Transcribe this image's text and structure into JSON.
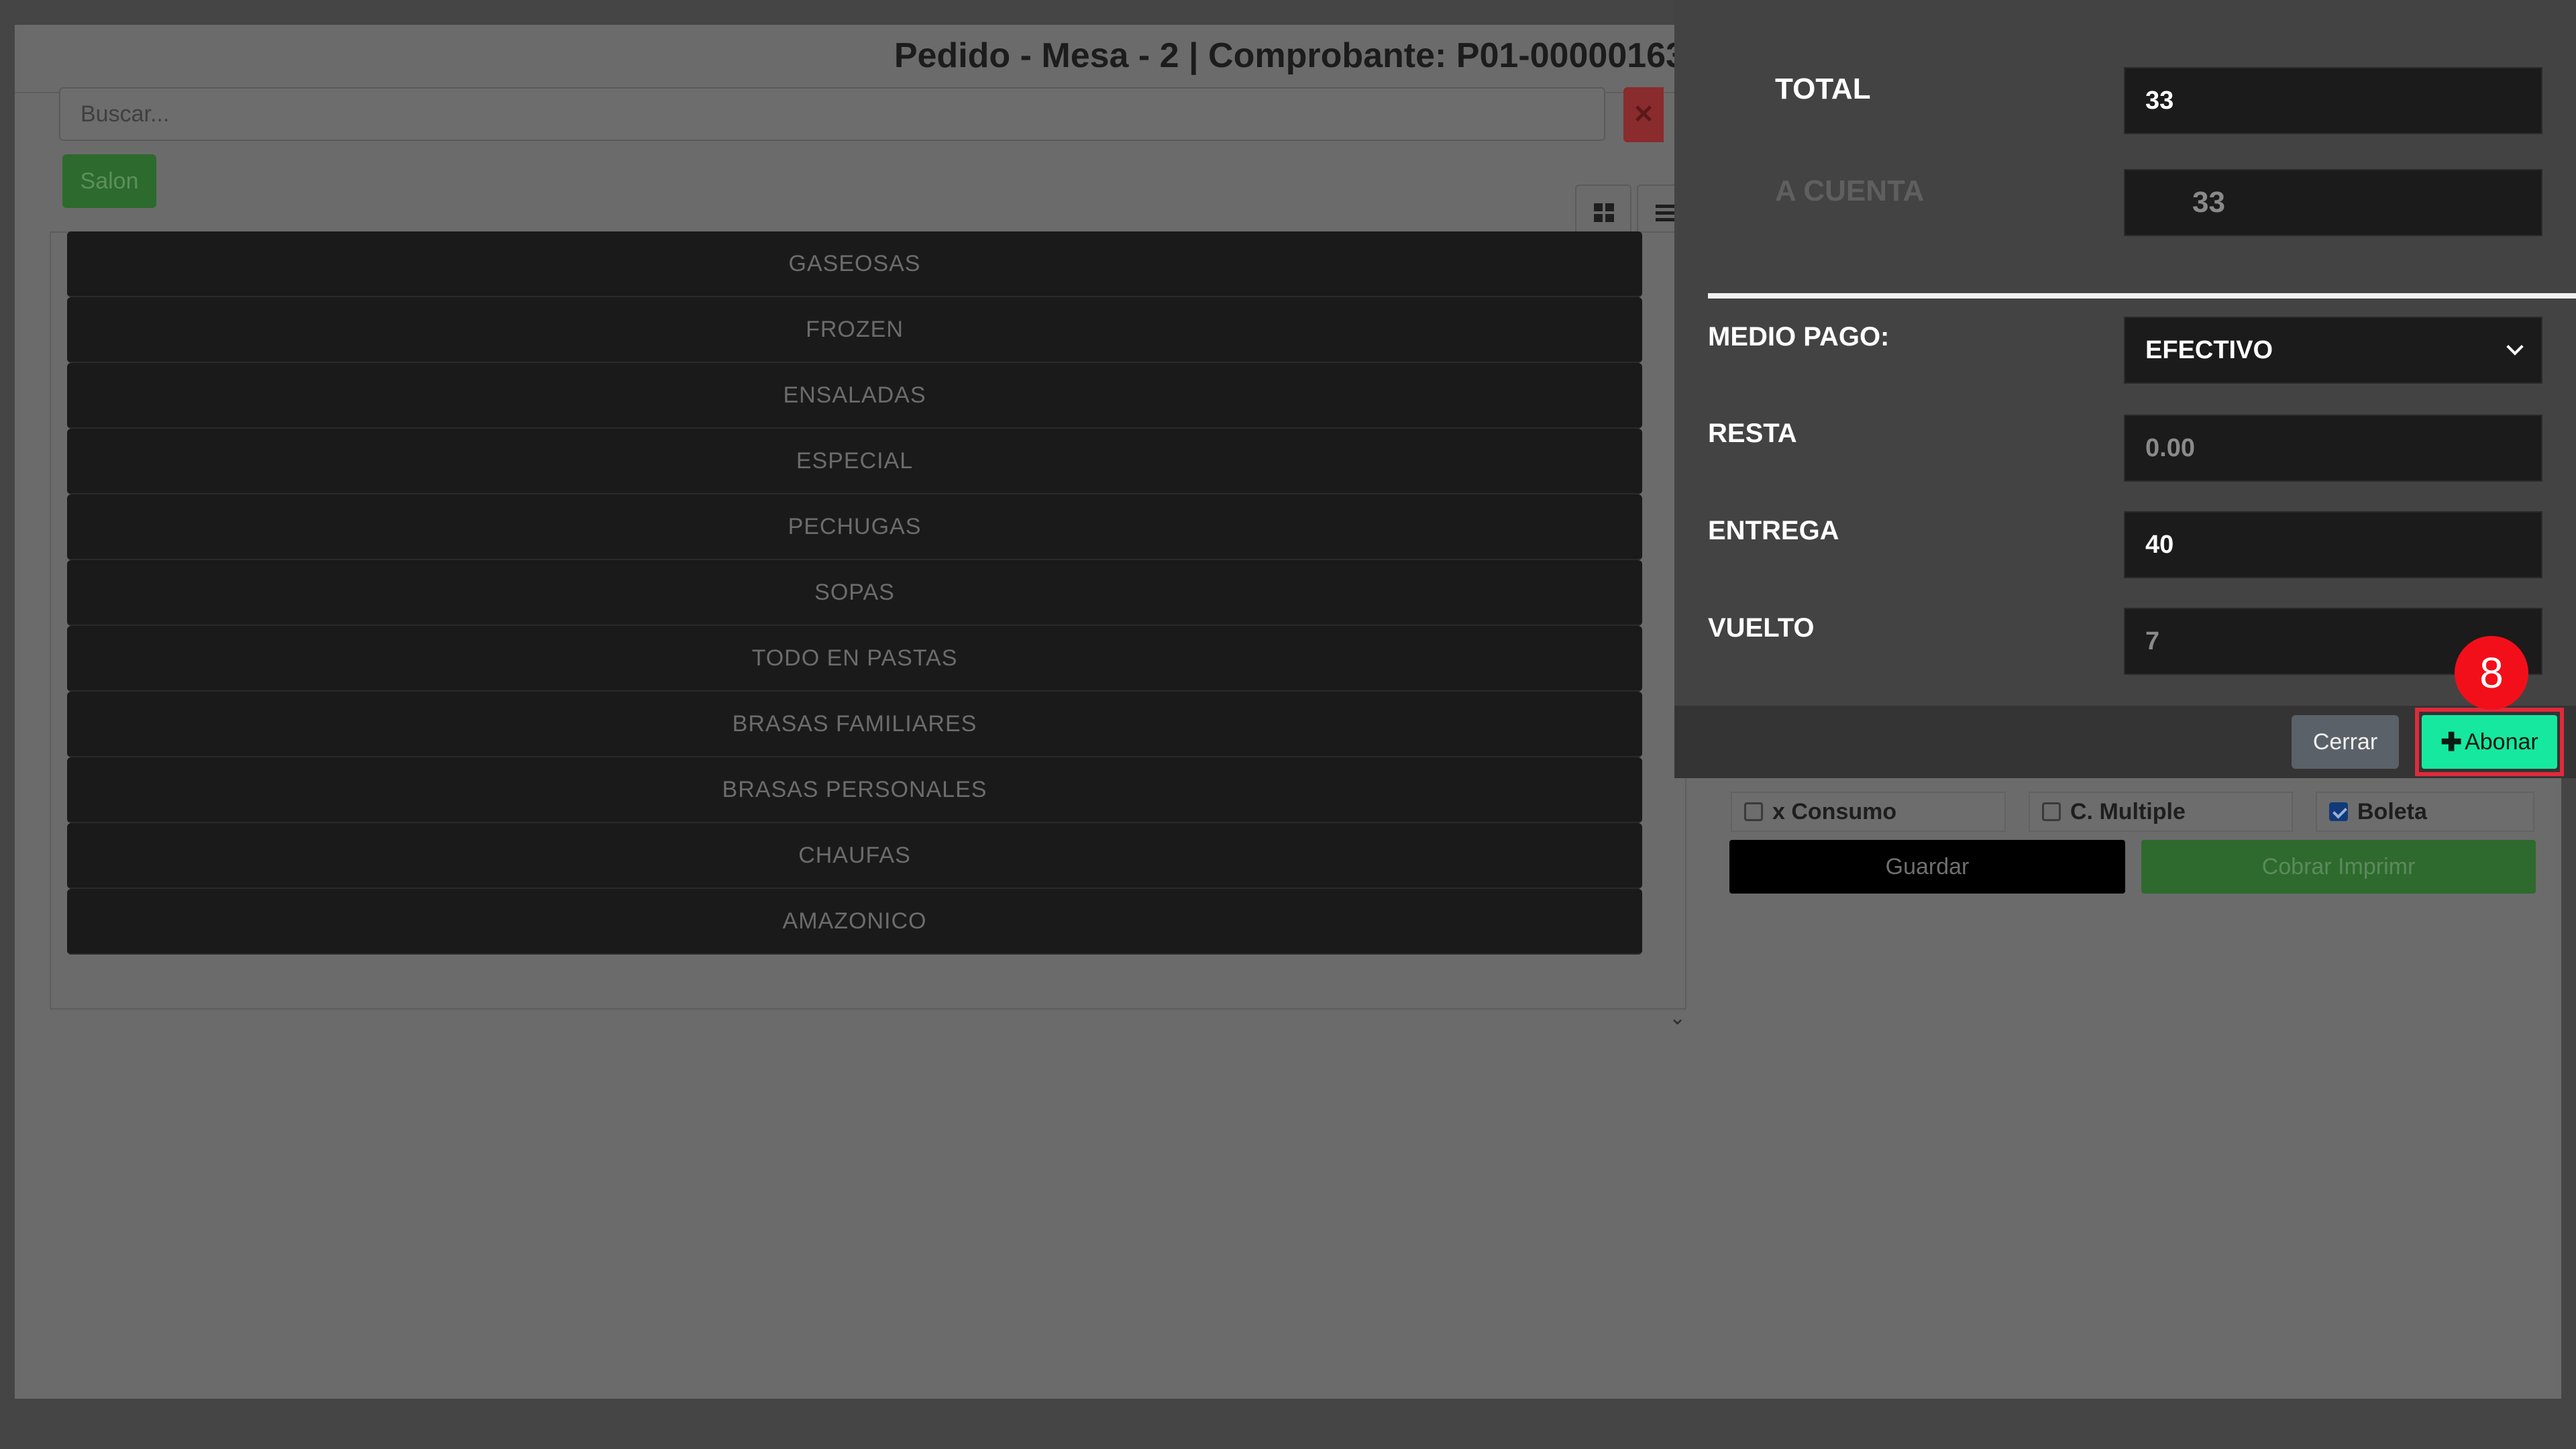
{
  "order_modal": {
    "title": "Pedido - Mesa - 2 | Comprobante: P01-00000163",
    "search_placeholder": "Buscar...",
    "clear_icon": "close-icon",
    "salon_label": "Salon",
    "view_icons": [
      "grid-icon",
      "list-icon"
    ],
    "categories": [
      "GASEOSAS",
      "FROZEN",
      "ENSALADAS",
      "ESPECIAL",
      "PECHUGAS",
      "SOPAS",
      "TODO EN PASTAS",
      "BRASAS FAMILIARES",
      "BRASAS PERSONALES",
      "CHAUFAS",
      "AMAZONICO"
    ]
  },
  "order_summary": {
    "checkboxes": [
      {
        "label": "x Consumo",
        "checked": false
      },
      {
        "label": "C. Multiple",
        "checked": false
      },
      {
        "label": "Boleta",
        "checked": true
      }
    ],
    "guardar_label": "Guardar",
    "cobrar_label": "Cobrar Imprimr"
  },
  "payment": {
    "total_label": "TOTAL",
    "total_value": "33",
    "a_cuenta_label": "A CUENTA",
    "a_cuenta_value": "33",
    "medio_pago_label": "MEDIO PAGO:",
    "medio_pago_value": "EFECTIVO",
    "resta_label": "RESTA",
    "resta_value": "0.00",
    "entrega_label": "ENTREGA",
    "entrega_value": "40",
    "vuelto_label": "VUELTO",
    "vuelto_value": "7",
    "cerrar_label": "Cerrar",
    "abonar_label": "Abonar",
    "step_badge": "8"
  },
  "colors": {
    "abonar": "#16e8a0",
    "highlight": "#e02a3a",
    "badge": "#f20f1a"
  }
}
